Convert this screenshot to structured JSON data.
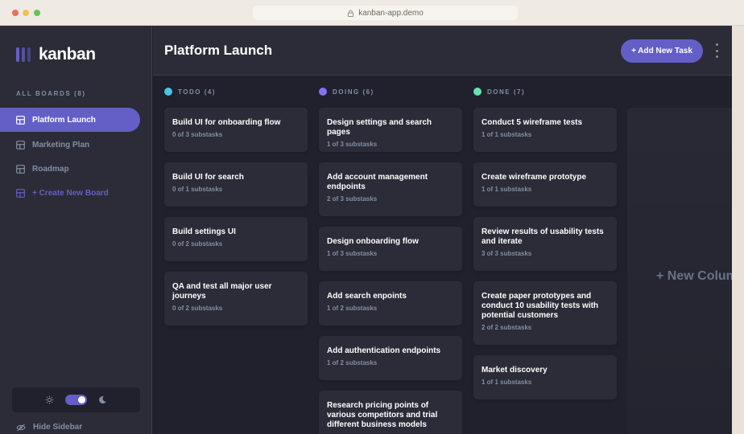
{
  "browser": {
    "url": "kanban-app.demo"
  },
  "sidebar": {
    "logo": "kanban",
    "boards_heading": "ALL BOARDS (8)",
    "boards": [
      {
        "label": "Platform Launch",
        "active": true
      },
      {
        "label": "Marketing Plan",
        "active": false
      },
      {
        "label": "Roadmap",
        "active": false
      }
    ],
    "create_board": "+ Create New Board",
    "hide_sidebar": "Hide Sidebar",
    "theme": "dark"
  },
  "header": {
    "board_title": "Platform Launch",
    "add_task": "+ Add New Task"
  },
  "columns": [
    {
      "name": "TODO (4)",
      "color": "#49c4e5",
      "cards": [
        {
          "title": "Build UI for onboarding flow",
          "substasks": "0 of 3 substasks"
        },
        {
          "title": "Build UI for search",
          "substasks": "0 of 1 substasks"
        },
        {
          "title": "Build settings UI",
          "substasks": "0 of 2 substasks"
        },
        {
          "title": "QA and test all major user journeys",
          "substasks": "0 of 2 substasks"
        }
      ]
    },
    {
      "name": "DOING (6)",
      "color": "#8471f2",
      "cards": [
        {
          "title": "Design settings and search pages",
          "substasks": "1 of 3 substasks"
        },
        {
          "title": "Add account management endpoints",
          "substasks": "2 of 3 substasks"
        },
        {
          "title": "Design onboarding flow",
          "substasks": "1 of 3 substasks"
        },
        {
          "title": "Add search enpoints",
          "substasks": "1 of 2 substasks"
        },
        {
          "title": "Add authentication endpoints",
          "substasks": "1 of 2 substasks"
        },
        {
          "title": "Research pricing points of various competitors and trial different business models",
          "substasks": ""
        }
      ]
    },
    {
      "name": "DONE (7)",
      "color": "#67e2ae",
      "cards": [
        {
          "title": "Conduct 5 wireframe tests",
          "substasks": "1 of 1 substasks"
        },
        {
          "title": "Create wireframe prototype",
          "substasks": "1 of 1 substasks"
        },
        {
          "title": "Review results of usability tests and iterate",
          "substasks": "3 of 3 substasks"
        },
        {
          "title": "Create paper prototypes and conduct 10 usability tests with potential customers",
          "substasks": "2 of 2 substasks"
        },
        {
          "title": "Market discovery",
          "substasks": "1 of 1 substasks"
        }
      ]
    }
  ],
  "new_column": "+ New Column"
}
